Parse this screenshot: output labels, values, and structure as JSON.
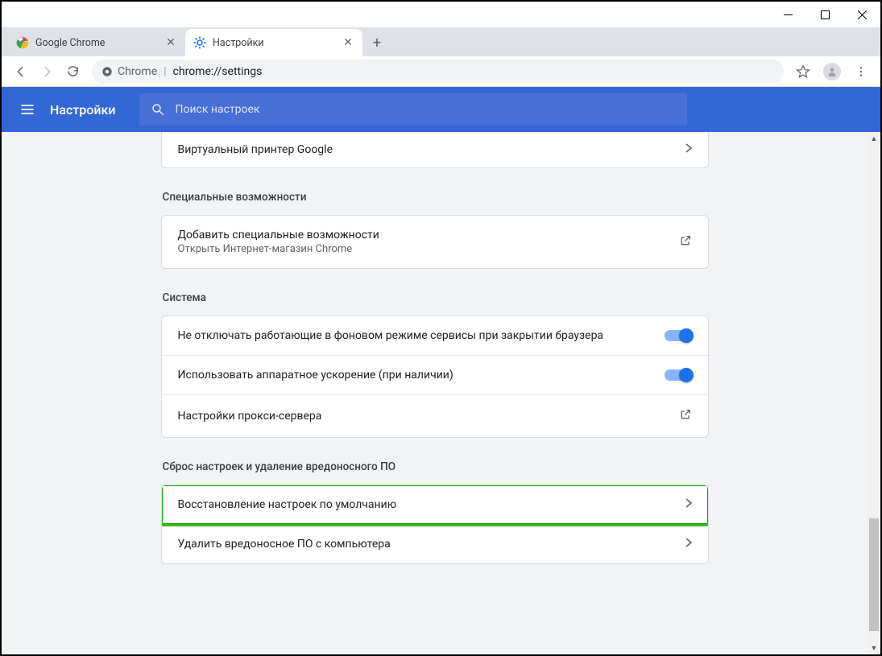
{
  "window": {
    "tabs": [
      {
        "label": "Google Chrome",
        "active": false
      },
      {
        "label": "Настройки",
        "active": true
      }
    ]
  },
  "omnibox": {
    "security_label": "Chrome",
    "url": "chrome://settings"
  },
  "header": {
    "title": "Настройки",
    "search_placeholder": "Поиск настроек"
  },
  "sections": {
    "top_row_label": "Виртуальный принтер Google",
    "accessibility": {
      "title": "Специальные возможности",
      "add_label": "Добавить специальные возможности",
      "add_sub": "Открыть Интернет-магазин Chrome"
    },
    "system": {
      "title": "Система",
      "bg_label": "Не отключать работающие в фоновом режиме сервисы при закрытии браузера",
      "hw_label": "Использовать аппаратное ускорение (при наличии)",
      "proxy_label": "Настройки прокси-сервера",
      "bg_on": true,
      "hw_on": true
    },
    "reset": {
      "title": "Сброс настроек и удаление вредоносного ПО",
      "restore_label": "Восстановление настроек по умолчанию",
      "cleanup_label": "Удалить вредоносное ПО с компьютера"
    }
  }
}
